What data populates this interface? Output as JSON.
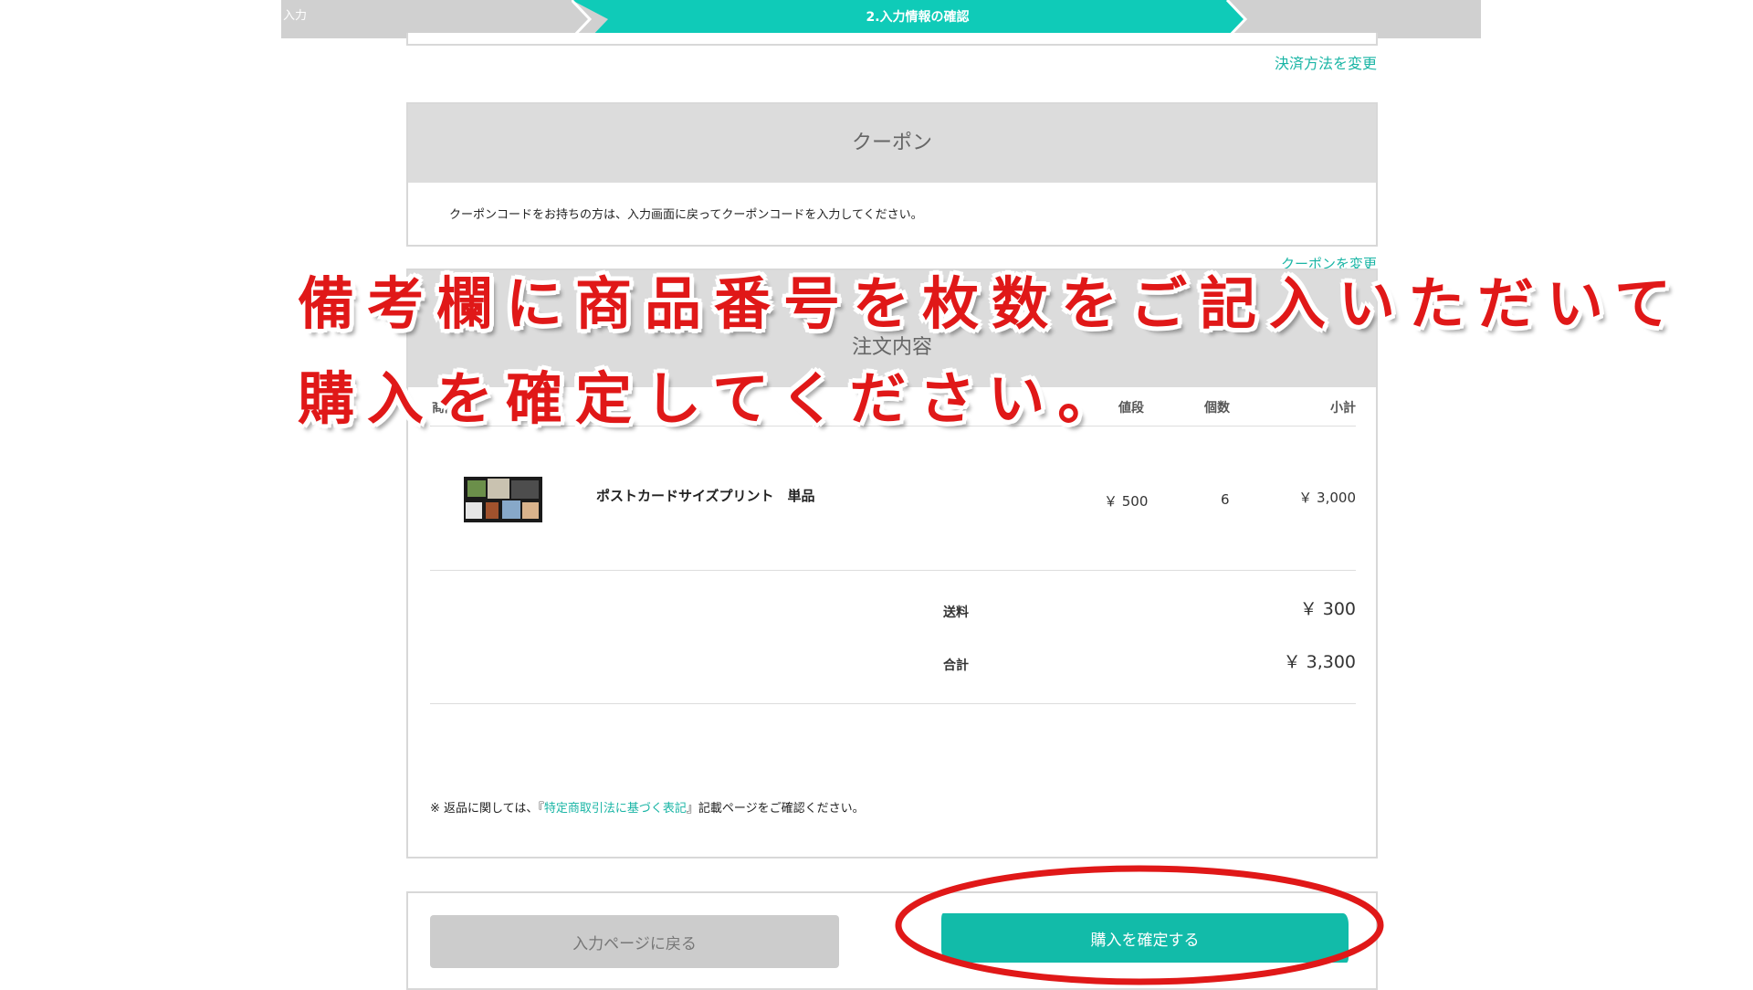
{
  "steps": {
    "step1_label": "入力",
    "step2_label": "2.入力情報の確認"
  },
  "payment": {
    "change_link": "決済方法を変更"
  },
  "coupon": {
    "title": "クーポン",
    "instruction": "クーポンコードをお持ちの方は、入力画面に戻ってクーポンコードを入力してください。",
    "change_link": "クーポンを変更"
  },
  "order": {
    "title": "注文内容",
    "columns": {
      "name": "商品",
      "price": "値段",
      "qty": "個数",
      "subtotal": "小計"
    },
    "items": [
      {
        "name": "ポストカードサイズプリント　単品",
        "price": "￥ 500",
        "qty": "6",
        "subtotal": "￥ 3,000"
      }
    ],
    "shipping_label": "送料",
    "shipping_value": "￥ 300",
    "total_label": "合計",
    "total_value": "￥ 3,300",
    "return_note_prefix": "※ 返品に関しては、『",
    "return_note_link": "特定商取引法に基づく表記",
    "return_note_suffix": "』記載ページをご確認ください。"
  },
  "actions": {
    "back_label": "入力ページに戻る",
    "confirm_label": "購入を確定する"
  },
  "annotation": {
    "line1": "備考欄に商品番号を枚数をご記入いただいて",
    "line2": "購入を確定してください。",
    "color": "#e01818"
  },
  "colors": {
    "accent": "#12bba9",
    "step_active": "#0fcbb8",
    "step_inactive": "#d0d0d0"
  }
}
